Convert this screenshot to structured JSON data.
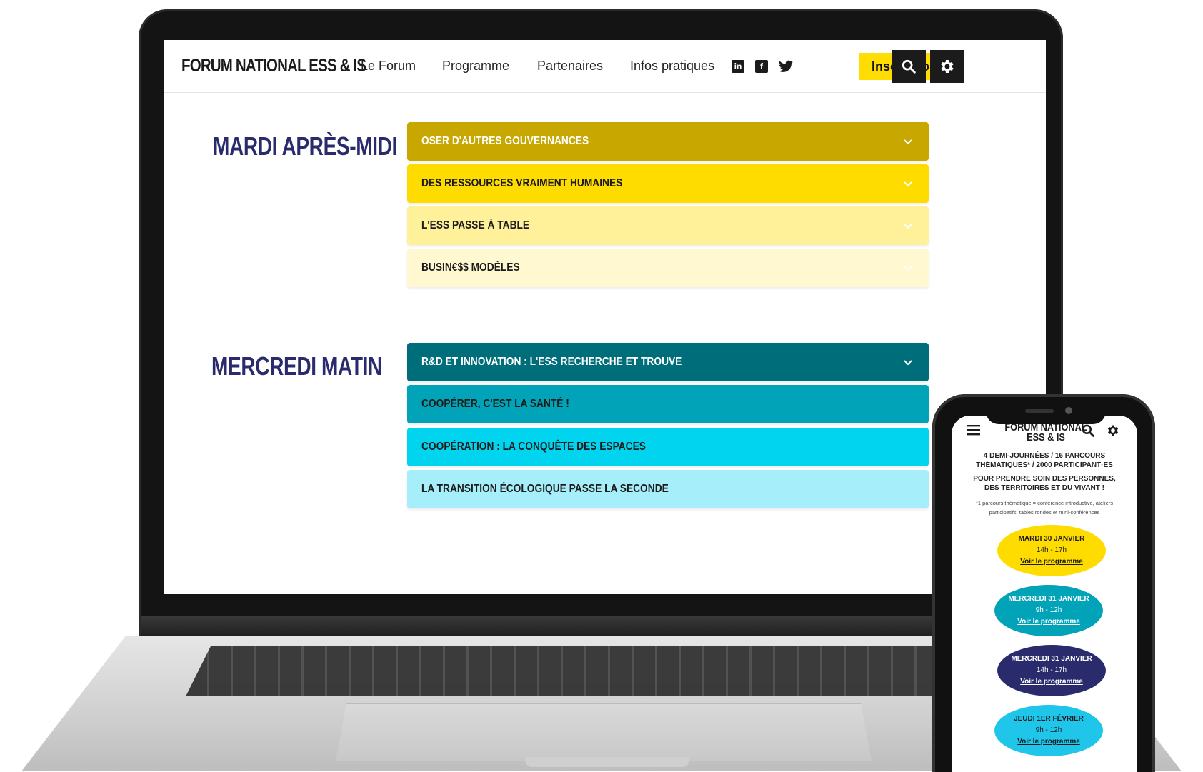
{
  "brand": "FORUM NATIONAL ESS & IS",
  "nav": [
    {
      "label": "Le Forum"
    },
    {
      "label": "Programme"
    },
    {
      "label": "Partenaires"
    },
    {
      "label": "Infos pratiques"
    }
  ],
  "social": [
    {
      "icon": "linkedin-icon",
      "glyph": "in"
    },
    {
      "icon": "facebook-icon",
      "glyph": "f"
    },
    {
      "icon": "twitter-icon",
      "glyph": "🐦"
    }
  ],
  "header": {
    "inscription_label": "Inscription"
  },
  "sections": [
    {
      "title": "MARDI APRÈS-MIDI",
      "items": [
        {
          "label": "OSER D'AUTRES GOUVERNANCES",
          "color": "#c8a800",
          "text": "#ffffff"
        },
        {
          "label": "DES RESSOURCES VRAIMENT HUMAINES",
          "color": "#ffdc00",
          "text": "#1b1b1b"
        },
        {
          "label": "L'ESS PASSE À TABLE",
          "color": "#fff09a",
          "text": "#1b1b1b"
        },
        {
          "label": "BUSIN€$$ MODÈLES",
          "color": "#fff8d0",
          "text": "#1b1b1b"
        }
      ]
    },
    {
      "title": "MERCREDI MATIN",
      "items": [
        {
          "label": "R&D ET INNOVATION : L'ESS RECHERCHE ET TROUVE",
          "color": "#006e7a",
          "text": "#ffffff"
        },
        {
          "label": "COOPÉRER, C'EST LA SANTÉ !",
          "color": "#00a3b8",
          "text": "#1b1b1b"
        },
        {
          "label": "COOPÉRATION : LA CONQUÊTE DES ESPACES",
          "color": "#00d4ef",
          "text": "#1b1b1b"
        },
        {
          "label": "LA TRANSITION ÉCOLOGIQUE PASSE LA SECONDE",
          "color": "#a6eef9",
          "text": "#1b1b1b"
        }
      ]
    }
  ],
  "phone": {
    "brand": "FORUM NATIONAL ESS & IS",
    "tagline": "4 DEMI-JOURNÉES / 16 PARCOURS THÉMATIQUES* / 2000 PARTICIPANT·ES",
    "subtitle": "POUR PRENDRE SOIN DES PERSONNES, DES TERRITOIRES ET DU VIVANT !",
    "note": "*1 parcours thématique = conférence introductive, ateliers participatifs, tables rondes et mini-conférences",
    "days": [
      {
        "day": "MARDI 30 JANVIER",
        "time": "14h - 17h",
        "link": "Voir le programme",
        "color": "#ffdc00",
        "text": "#1b1b1b"
      },
      {
        "day": "MERCREDI 31 JANVIER",
        "time": "9h - 12h",
        "link": "Voir le programme",
        "color": "#00a3b8",
        "text": "#ffffff"
      },
      {
        "day": "MERCREDI 31 JANVIER",
        "time": "14h - 17h",
        "link": "Voir le programme",
        "color": "#2a2b6d",
        "text": "#ffffff"
      },
      {
        "day": "JEUDI 1ER FÉVRIER",
        "time": "9h - 12h",
        "link": "Voir le programme",
        "color": "#1fc6ea",
        "text": "#1b1b1b"
      }
    ]
  }
}
